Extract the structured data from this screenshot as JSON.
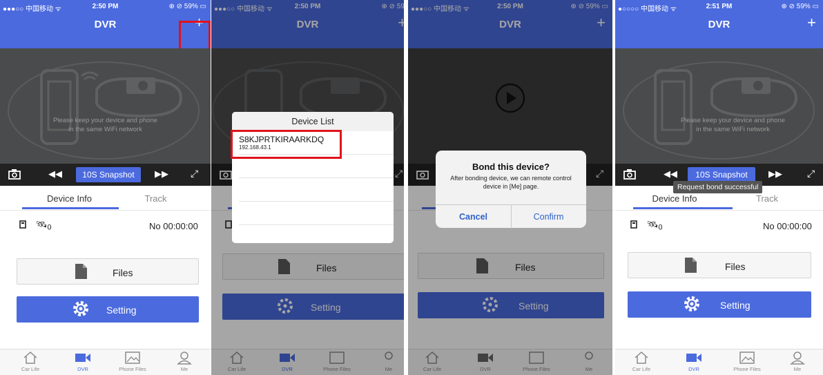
{
  "status": {
    "carrier": "●●●○○ 中国移动 ᯤ",
    "carrier4": "●○○○○ 中国移动 ᯤ",
    "time1": "2:50 PM",
    "time4": "2:51 PM",
    "battery": "⊕ ⊘ 59% ▭"
  },
  "nav": {
    "title": "DVR",
    "add": "+"
  },
  "video": {
    "hint_line1": "Please keep your device and phone",
    "hint_line2": "in the same WiFi network"
  },
  "controls": {
    "rewind": "◀◀",
    "snapshot": "10S Snapshot",
    "forward": "▶▶",
    "fullscreen": "⤢"
  },
  "tabs": {
    "info": "Device Info",
    "track": "Track"
  },
  "info": {
    "recording": "No 00:00:00",
    "satellite_count": "0"
  },
  "buttons": {
    "files": "Files",
    "setting": "Setting"
  },
  "tabbar": {
    "car_life": "Car Life",
    "dvr": "DVR",
    "phone_files": "Phone Files",
    "me": "Me"
  },
  "device_list": {
    "title": "Device List",
    "device_name": "S8KJPRTKIRAARKDQ",
    "device_ip": "192.168.43.1"
  },
  "bond_dialog": {
    "title": "Bond this device?",
    "message": "After bonding device, we can remote control device in [Me] page.",
    "cancel": "Cancel",
    "confirm": "Confirm"
  },
  "toast": "Request bond successful",
  "colors": {
    "brand": "#4b6ade",
    "highlight": "#e0131b",
    "dark": "#4a4b4c"
  }
}
